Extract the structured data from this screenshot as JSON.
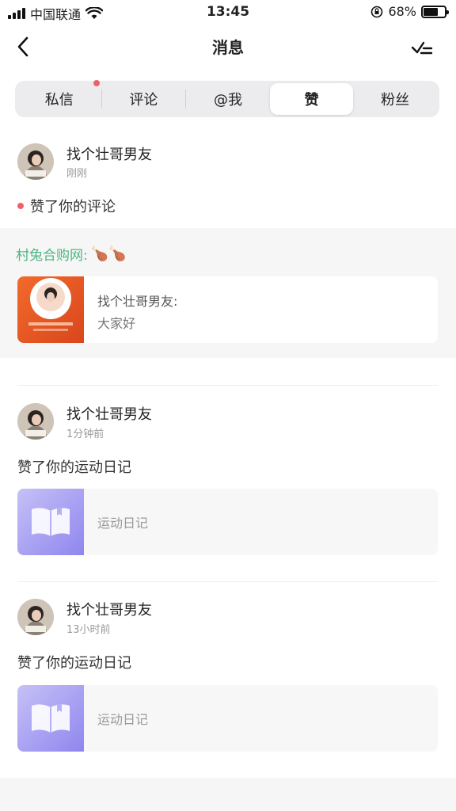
{
  "status_bar": {
    "carrier": "中国联通",
    "time": "13:45",
    "battery": "68%",
    "battery_level": 0.68
  },
  "nav": {
    "title": "消息"
  },
  "tabs": [
    {
      "label": "私信",
      "active": false,
      "unread_dot": true
    },
    {
      "label": "评论",
      "active": false,
      "unread_dot": false
    },
    {
      "label": "@我",
      "active": false,
      "unread_dot": false
    },
    {
      "label": "赞",
      "active": true,
      "unread_dot": false
    },
    {
      "label": "粉丝",
      "active": false,
      "unread_dot": false
    }
  ],
  "entries": [
    {
      "name": "找个壮哥男友",
      "time": "刚刚",
      "action": "赞了你的评论",
      "unread": true,
      "quote": {
        "source": "村兔合购网:",
        "emoji": "🍗🍗",
        "author": "找个壮哥男友:",
        "text": "大家好"
      }
    },
    {
      "name": "找个壮哥男友",
      "time": "1分钟前",
      "action": "赞了你的运动日记",
      "card_label": "运动日记"
    },
    {
      "name": "找个壮哥男友",
      "time": "13小时前",
      "action": "赞了你的运动日记",
      "card_label": "运动日记"
    }
  ],
  "colors": {
    "accent_green": "#4cb67f",
    "unread_red": "#f0606a",
    "diary_purple": "#9b92f0"
  }
}
